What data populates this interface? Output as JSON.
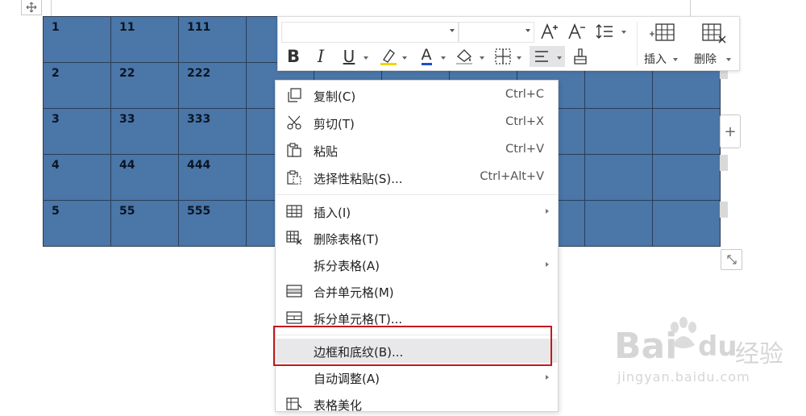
{
  "table": {
    "rows": [
      [
        "1",
        "11",
        "111",
        "",
        "",
        "",
        "",
        "",
        "",
        ""
      ],
      [
        "2",
        "22",
        "222",
        "",
        "",
        "",
        "",
        "",
        "",
        ""
      ],
      [
        "3",
        "33",
        "333",
        "",
        "",
        "",
        "",
        "",
        "",
        ""
      ],
      [
        "4",
        "44",
        "444",
        "",
        "",
        "",
        "",
        "",
        "",
        ""
      ],
      [
        "5",
        "55",
        "555",
        "",
        "",
        "",
        "",
        "",
        "",
        ""
      ]
    ],
    "cell_color": "#4a76a8"
  },
  "mini_toolbar": {
    "increase_font_icon": "A+",
    "decrease_font_icon": "A-",
    "bold": "B",
    "italic": "I",
    "underline": "U",
    "font_color": "A",
    "insert_label": "插入",
    "delete_label": "删除"
  },
  "context_menu": {
    "items": [
      {
        "label": "复制(C)",
        "shortcut": "Ctrl+C",
        "icon": "copy-icon"
      },
      {
        "label": "剪切(T)",
        "shortcut": "Ctrl+X",
        "icon": "scissors-icon"
      },
      {
        "label": "粘贴",
        "shortcut": "Ctrl+V",
        "icon": "paste-icon"
      },
      {
        "label": "选择性粘贴(S)...",
        "shortcut": "Ctrl+Alt+V",
        "icon": "paste-special-icon"
      },
      {
        "label": "插入(I)",
        "shortcut": "",
        "icon": "insert-table-icon"
      },
      {
        "label": "删除表格(T)",
        "shortcut": "",
        "icon": "delete-table-icon"
      },
      {
        "label": "拆分表格(A)",
        "shortcut": "",
        "icon": ""
      },
      {
        "label": "合并单元格(M)",
        "shortcut": "",
        "icon": "merge-cells-icon"
      },
      {
        "label": "拆分单元格(T)...",
        "shortcut": "",
        "icon": "split-cells-icon"
      },
      {
        "label": "边框和底纹(B)...",
        "shortcut": "",
        "icon": ""
      },
      {
        "label": "自动调整(A)",
        "shortcut": "",
        "icon": ""
      },
      {
        "label": "表格美化",
        "shortcut": "",
        "icon": "table-beautify-icon"
      }
    ],
    "highlight_color": "#c4191c"
  },
  "watermark": {
    "brand": "Bai",
    "brand_tail": "du",
    "cn": "经验",
    "url": "jingyan.baidu.com"
  }
}
